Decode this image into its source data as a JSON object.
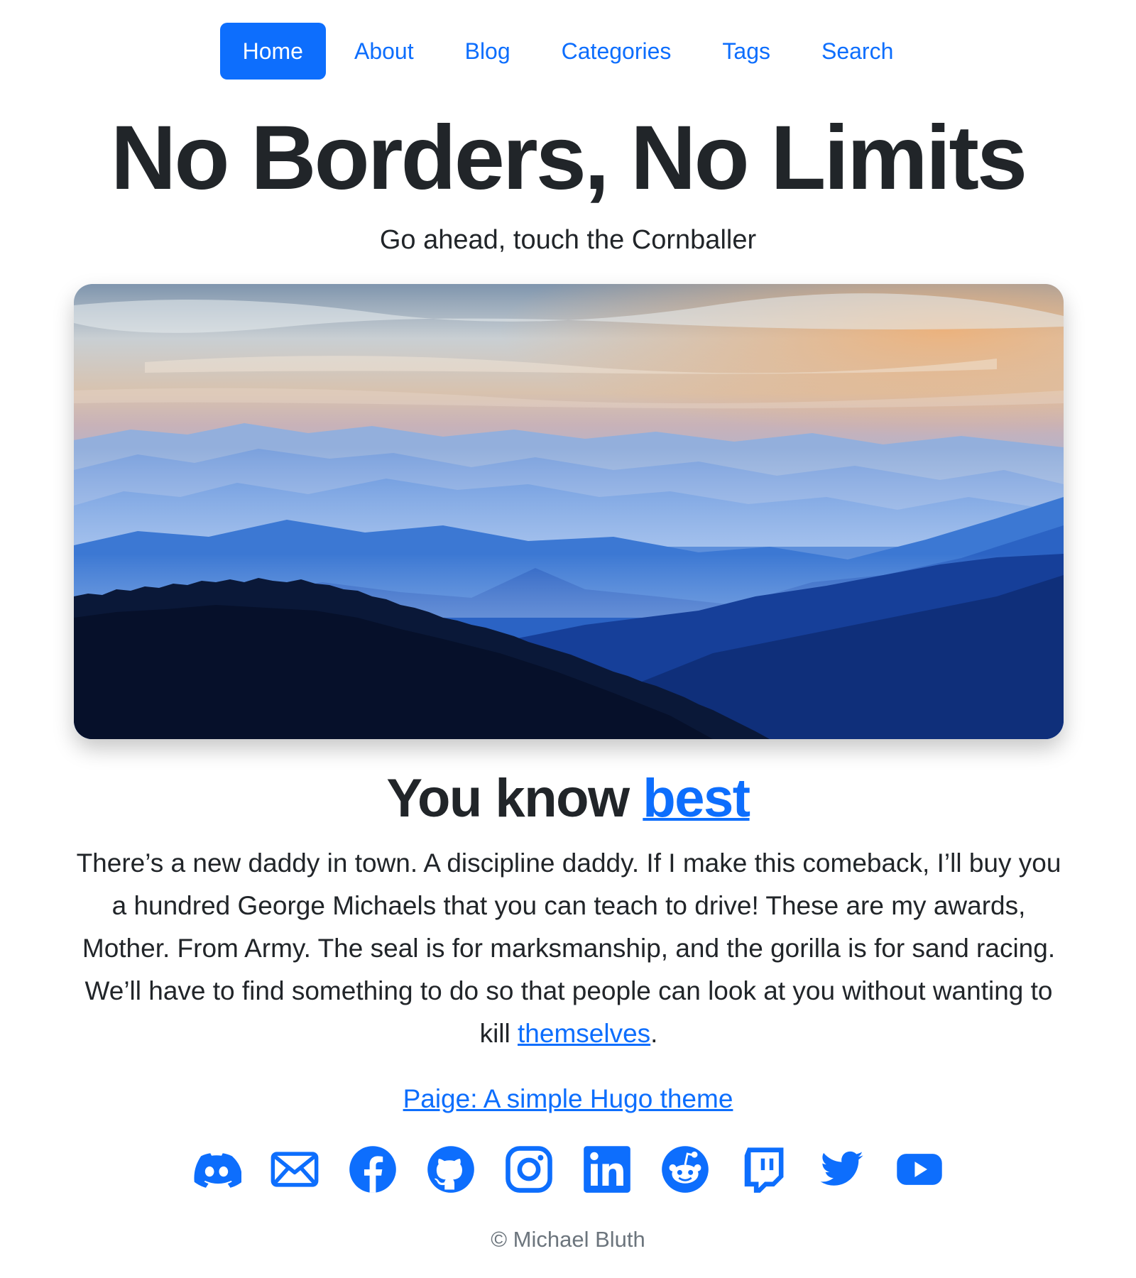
{
  "nav": {
    "items": [
      {
        "label": "Home",
        "active": true
      },
      {
        "label": "About"
      },
      {
        "label": "Blog"
      },
      {
        "label": "Categories"
      },
      {
        "label": "Tags"
      },
      {
        "label": "Search"
      }
    ]
  },
  "header": {
    "title": "No Borders, No Limits",
    "subtitle": "Go ahead, touch the Cornballer"
  },
  "main": {
    "heading_prefix": "You know",
    "heading_link": "best",
    "paragraph_text": "There’s a new daddy in town. A discipline daddy. If I make this comeback, I’ll buy you a hundred George Michaels that you can teach to drive! These are my awards, Mother. From Army. The seal is for marksmanship, and the gorilla is for sand racing. We’ll have to find something to do so that people can look at you without wanting to kill",
    "paragraph_link": "themselves",
    "paragraph_end": ".",
    "theme_link": "Paige: A simple Hugo theme"
  },
  "social": [
    "discord-icon",
    "email-icon",
    "facebook-icon",
    "github-icon",
    "instagram-icon",
    "linkedin-icon",
    "reddit-icon",
    "twitch-icon",
    "twitter-icon",
    "youtube-icon"
  ],
  "footer": {
    "copyright": "© Michael Bluth"
  },
  "colors": {
    "accent": "#0d6efd",
    "text": "#212529",
    "muted": "#6c757d"
  }
}
